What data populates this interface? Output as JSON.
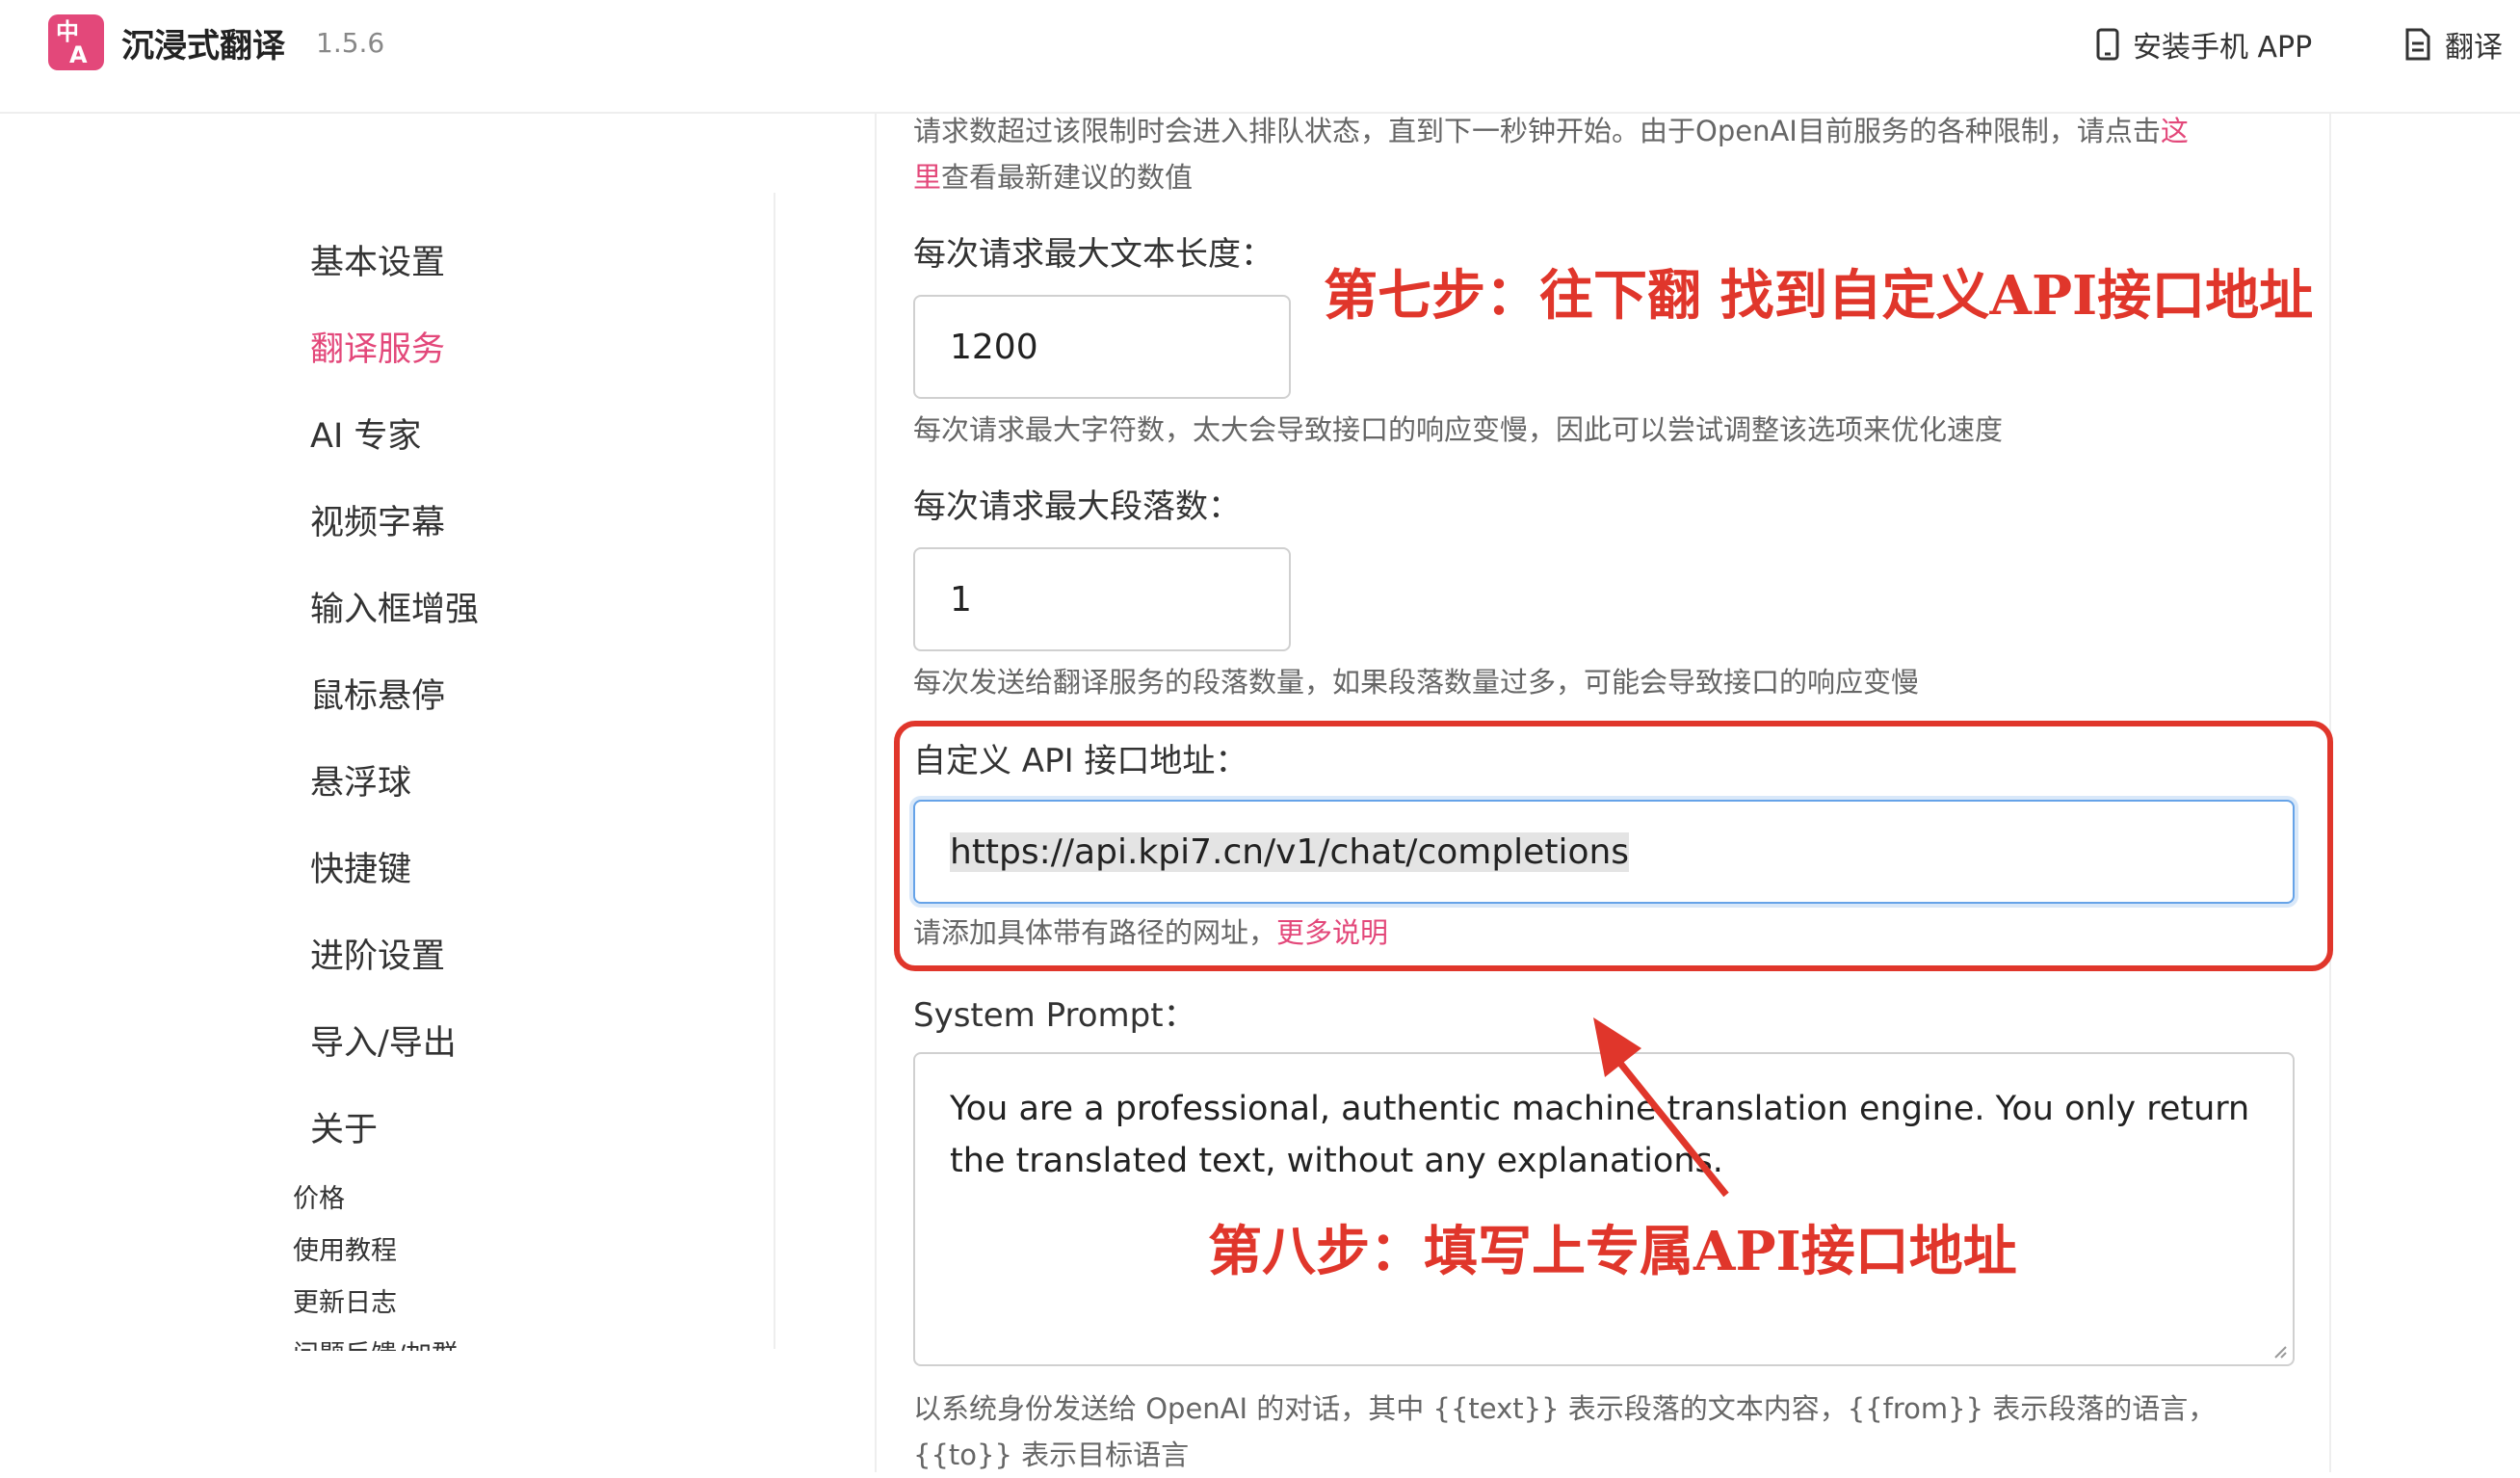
{
  "header": {
    "logo_top": "中",
    "logo_bottom": "A",
    "app_name": "沉浸式翻译",
    "version": "1.5.6",
    "links": [
      {
        "label": "安装手机 APP"
      },
      {
        "label": "翻译"
      }
    ]
  },
  "sidebar": {
    "items": [
      {
        "label": "基本设置"
      },
      {
        "label": "翻译服务"
      },
      {
        "label": "AI 专家"
      },
      {
        "label": "视频字幕"
      },
      {
        "label": "输入框增强"
      },
      {
        "label": "鼠标悬停"
      },
      {
        "label": "悬浮球"
      },
      {
        "label": "快捷键"
      },
      {
        "label": "进阶设置"
      },
      {
        "label": "导入/导出"
      },
      {
        "label": "关于"
      }
    ],
    "sub_items": [
      {
        "label": "价格"
      },
      {
        "label": "使用教程"
      },
      {
        "label": "更新日志"
      },
      {
        "label": "问题反馈/加群"
      }
    ],
    "active_index": 1
  },
  "main": {
    "rate_help_line1": "请求数超过该限制时会进入排队状态，直到下一秒钟开始。由于OpenAI目前服务的各种限制，请点击",
    "rate_help_link1": "这",
    "rate_help_link2": "里",
    "rate_help_line2": "查看最新建议的数值",
    "max_text_label": "每次请求最大文本长度：",
    "max_text_value": "1200",
    "max_text_help": "每次请求最大字符数，太大会导致接口的响应变慢，因此可以尝试调整该选项来优化速度",
    "max_para_label": "每次请求最大段落数：",
    "max_para_value": "1",
    "max_para_help": "每次发送给翻译服务的段落数量，如果段落数量过多，可能会导致接口的响应变慢",
    "api_label": "自定义 API 接口地址：",
    "api_value": "https://api.kpi7.cn/v1/chat/completions",
    "api_help": "请添加具体带有路径的网址，",
    "api_help_link": "更多说明",
    "prompt_label": "System Prompt：",
    "prompt_value": "You are a professional, authentic machine translation engine. You only return the translated text, without any explanations.",
    "prompt_help_line1": "以系统身份发送给 OpenAI 的对话，其中 {{text}} 表示段落的文本内容，{{from}} 表示段落的语言，",
    "prompt_help_line2": "{{to}} 表示目标语言"
  },
  "annotations": {
    "step7": "第七步：往下翻 找到自定义API接口地址",
    "step8": "第八步：填写上专属API接口地址",
    "color": "#e0362b"
  },
  "colors": {
    "accent": "#e3487a",
    "annotation": "#e0362b",
    "focus": "#66a3e8"
  }
}
